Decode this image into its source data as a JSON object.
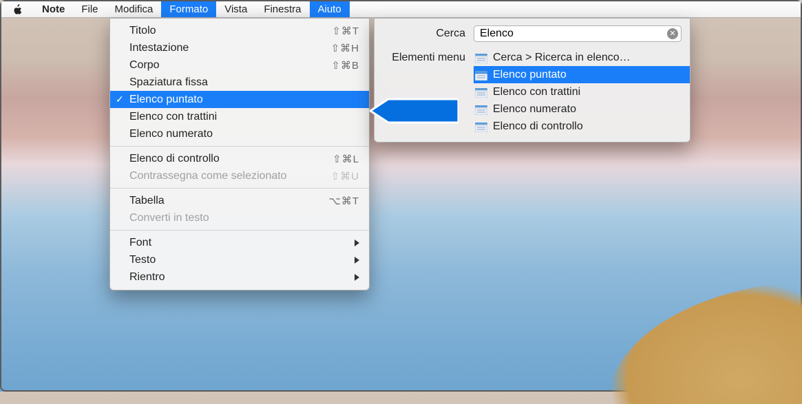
{
  "menubar": {
    "app": "Note",
    "items": [
      {
        "label": "File",
        "active": false
      },
      {
        "label": "Modifica",
        "active": false
      },
      {
        "label": "Formato",
        "active": true
      },
      {
        "label": "Vista",
        "active": false
      },
      {
        "label": "Finestra",
        "active": false
      },
      {
        "label": "Aiuto",
        "active": true
      }
    ]
  },
  "formato_menu": {
    "groups": [
      [
        {
          "label": "Titolo",
          "shortcut": "⇧⌘T"
        },
        {
          "label": "Intestazione",
          "shortcut": "⇧⌘H"
        },
        {
          "label": "Corpo",
          "shortcut": "⇧⌘B"
        },
        {
          "label": "Spaziatura fissa"
        },
        {
          "label": "Elenco puntato",
          "checked": true,
          "highlight": true
        },
        {
          "label": "Elenco con trattini"
        },
        {
          "label": "Elenco numerato"
        }
      ],
      [
        {
          "label": "Elenco di controllo",
          "shortcut": "⇧⌘L"
        },
        {
          "label": "Contrassegna come selezionato",
          "shortcut": "⇧⌘U",
          "disabled": true
        }
      ],
      [
        {
          "label": "Tabella",
          "shortcut": "⌥⌘T"
        },
        {
          "label": "Converti in testo",
          "disabled": true
        }
      ],
      [
        {
          "label": "Font",
          "submenu": true
        },
        {
          "label": "Testo",
          "submenu": true
        },
        {
          "label": "Rientro",
          "submenu": true
        }
      ]
    ]
  },
  "help_panel": {
    "search_label": "Cerca",
    "search_value": "Elenco",
    "section_label": "Elementi menu",
    "results": [
      {
        "label": "Cerca > Ricerca in elenco…"
      },
      {
        "label": "Elenco puntato",
        "highlight": true
      },
      {
        "label": "Elenco con trattini"
      },
      {
        "label": "Elenco numerato"
      },
      {
        "label": "Elenco di controllo"
      }
    ]
  }
}
